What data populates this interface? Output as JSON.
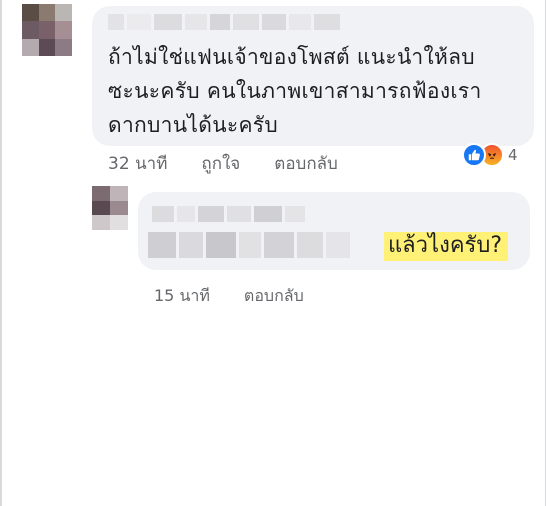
{
  "main_comment": {
    "text_lines": [
      "ถ้าไม่ใช่แฟนเจ้าของโพสต์ แนะนำให้ลบ",
      "ซะนะครับ คนในภาพเขาสามารถฟ้องเรา",
      "ดากบานได้นะครับ"
    ],
    "time": "32 นาที",
    "like_label": "ถูกใจ",
    "reply_label": "ตอบกลับ",
    "reaction_count": "4",
    "reactions": [
      "like-icon",
      "angry-icon"
    ]
  },
  "reply_comment": {
    "highlighted_text": "แล้วไงครับ?",
    "time": "15 นาที",
    "reply_label": "ตอบกลับ"
  },
  "colors": {
    "bubble": "#f0f2f5",
    "meta_text": "#65676b",
    "highlight": "#fff176",
    "like_blue": "#1877f2"
  }
}
